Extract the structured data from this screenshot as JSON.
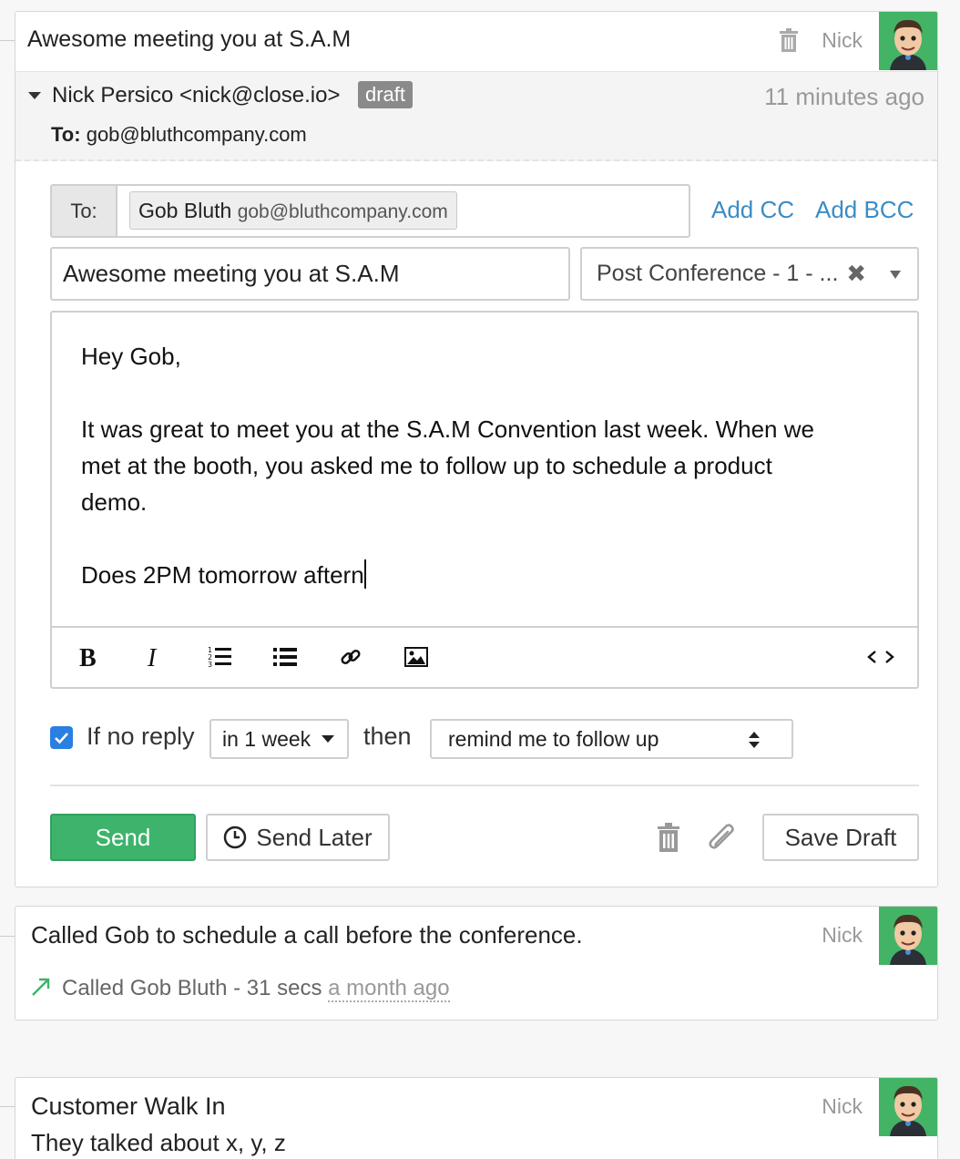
{
  "email": {
    "subject": "Awesome meeting you at S.A.M",
    "owner": "Nick",
    "from": "Nick Persico <nick@close.io>",
    "status_badge": "draft",
    "time_ago": "11 minutes ago",
    "to_label": "To:",
    "to_address": "gob@bluthcompany.com",
    "compose": {
      "to_field_label": "To:",
      "recipient_name": "Gob Bluth",
      "recipient_email": "gob@bluthcompany.com",
      "add_cc": "Add CC",
      "add_bcc": "Add BCC",
      "subject_value": "Awesome meeting you at S.A.M",
      "template_value": "Post Conference - 1 - ...",
      "body": {
        "greeting": "Hey Gob,",
        "line1": "It was great to meet you at the S.A.M Convention last week. When we",
        "line2": "met at the booth, you asked me to follow up to schedule a product",
        "line3": "demo.",
        "line4": "Does 2PM tomorrow aftern"
      },
      "toolbar_icons": [
        "bold-icon",
        "italic-icon",
        "ordered-list-icon",
        "unordered-list-icon",
        "link-icon",
        "image-icon",
        "code-view-icon"
      ],
      "followup": {
        "checked": true,
        "if_no_reply": "If no reply",
        "delay_value": "in 1 week",
        "then": "then",
        "action_value": "remind me to follow up"
      },
      "send": "Send",
      "send_later": "Send Later",
      "save_draft": "Save Draft"
    }
  },
  "call": {
    "note": "Called Gob to schedule a call before the conference.",
    "owner": "Nick",
    "detail": "Called Gob Bluth - 31 secs",
    "time_ago": "a month ago"
  },
  "walkin": {
    "title": "Customer Walk In",
    "owner": "Nick",
    "body": "They talked about x, y, z"
  },
  "colors": {
    "accent_link": "#3a8cc6",
    "send_green": "#3db36b",
    "avatar_bg": "#43b366",
    "checkbox_blue": "#2a7fe0"
  }
}
